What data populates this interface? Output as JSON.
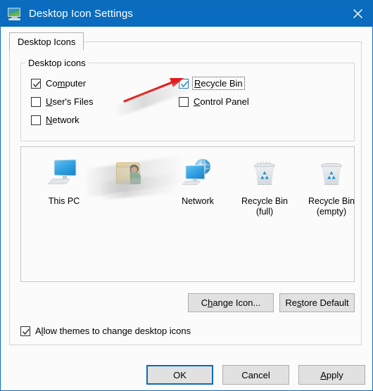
{
  "window": {
    "title": "Desktop Icon Settings",
    "title_icon": "desktop-monitor-icon",
    "close_label": "✕",
    "accent_color": "#0a6cbe",
    "titlebar_color": "#0a6cbe",
    "background_color": "#fbfbfb",
    "arrow_color": "#e11b1b"
  },
  "tabs": [
    {
      "label": "Desktop Icons",
      "selected": true
    }
  ],
  "group": {
    "legend": "Desktop icons",
    "checkboxes": [
      {
        "label": "Computer",
        "mnemonic": "m",
        "checked": true,
        "focused": false,
        "check_color": "#333333"
      },
      {
        "label": "User's Files",
        "mnemonic": "U",
        "checked": false,
        "focused": false,
        "check_color": "#333333"
      },
      {
        "label": "Network",
        "mnemonic": "N",
        "checked": false,
        "focused": false,
        "check_color": "#333333"
      },
      {
        "label": "Recycle Bin",
        "mnemonic": "R",
        "checked": true,
        "focused": true,
        "check_color": "#0a7cd4"
      },
      {
        "label": "Control Panel",
        "mnemonic": "C",
        "checked": false,
        "focused": false,
        "check_color": "#333333"
      }
    ]
  },
  "preview": {
    "icons": [
      {
        "caption_line1": "This PC",
        "caption_line2": "",
        "icon": "computer-monitor-icon"
      },
      {
        "caption_line1": "",
        "caption_line2": "",
        "icon": "user-folder-icon"
      },
      {
        "caption_line1": "Network",
        "caption_line2": "",
        "icon": "network-globe-icon"
      },
      {
        "caption_line1": "Recycle Bin",
        "caption_line2": "(full)",
        "icon": "recycle-bin-full-icon"
      },
      {
        "caption_line1": "Recycle Bin",
        "caption_line2": "(empty)",
        "icon": "recycle-bin-empty-icon"
      }
    ]
  },
  "actions": {
    "change_icon": {
      "label_pre": "C",
      "mnemonic": "h",
      "label_post": "ange Icon..."
    },
    "restore_default": {
      "label_pre": "Re",
      "mnemonic": "s",
      "label_post": "tore Default"
    }
  },
  "allow_themes": {
    "label_pre": "A",
    "mnemonic": "l",
    "label_post": "low themes to change desktop icons",
    "checked": true
  },
  "footer": {
    "ok": {
      "label": "OK",
      "default": true
    },
    "cancel": {
      "label": "Cancel",
      "default": false
    },
    "apply": {
      "label_pre": "",
      "mnemonic": "A",
      "label_post": "pply",
      "default": false
    }
  }
}
